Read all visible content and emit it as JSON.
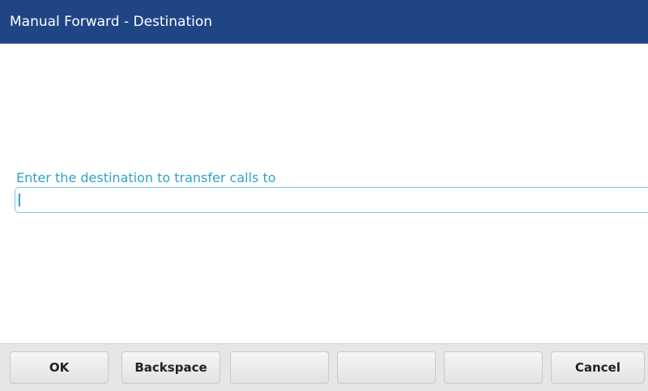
{
  "header": {
    "title": "Manual Forward - Destination"
  },
  "field": {
    "label": "Enter the destination to transfer calls to",
    "value": ""
  },
  "softkeys": [
    {
      "label": "OK"
    },
    {
      "label": "Backspace"
    },
    {
      "label": ""
    },
    {
      "label": ""
    },
    {
      "label": ""
    },
    {
      "label": "Cancel"
    }
  ],
  "colors": {
    "title_bar": "#1f4585",
    "accent": "#2ea3c8",
    "softkey_bar": "#e6e6e6"
  }
}
